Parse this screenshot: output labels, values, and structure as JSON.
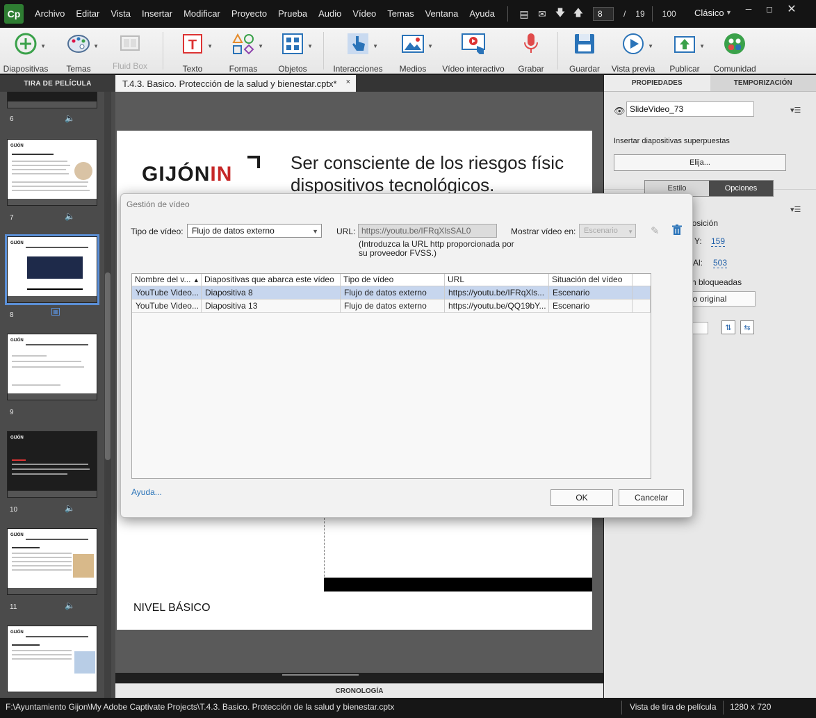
{
  "menubar": {
    "logo": "Cp",
    "items": [
      "Archivo",
      "Editar",
      "Vista",
      "Insertar",
      "Modificar",
      "Proyecto",
      "Prueba",
      "Audio",
      "Vídeo",
      "Temas",
      "Ventana",
      "Ayuda"
    ],
    "current_slide": "8",
    "slide_separator": "/",
    "total_slides": "19",
    "zoom": "100",
    "workspace": "Clásico"
  },
  "toolbar": {
    "diapositivas": "Diapositivas",
    "temas": "Temas",
    "fluid_box": "Fluid Box",
    "texto": "Texto",
    "formas": "Formas",
    "objetos": "Objetos",
    "interacciones": "Interacciones",
    "medios": "Medios",
    "video_interactivo": "Vídeo interactivo",
    "grabar": "Grabar",
    "guardar": "Guardar",
    "vista_previa": "Vista previa",
    "publicar": "Publicar",
    "comunidad": "Comunidad"
  },
  "filmstrip": {
    "header": "TIRA DE PELÍCULA",
    "slides": [
      {
        "num": "6"
      },
      {
        "num": "7"
      },
      {
        "num": "8"
      },
      {
        "num": "9"
      },
      {
        "num": "10"
      },
      {
        "num": "11"
      }
    ]
  },
  "document": {
    "tab_title": "T.4.3. Basico. Protección de la salud y bienestar.cptx*",
    "tab_close": "×"
  },
  "slide": {
    "logo_text": "GIJÓN",
    "logo_accent": "IN",
    "title_line1": "Ser consciente de los riesgos físic",
    "title_line2": "dispositivos tecnológicos.",
    "footer": "NIVEL BÁSICO"
  },
  "timeline": {
    "label": "CRONOLOGÍA"
  },
  "properties": {
    "tab_props": "PROPIEDADES",
    "tab_timing": "TEMPORIZACIÓN",
    "object_name": "SlideVideo_73",
    "overlay_label": "Insertar diapositivas superpuestas",
    "choose_button": "Elija...",
    "seg_style": "Estilo",
    "seg_options": "Opciones",
    "position_label": "posición",
    "y_label": "Y:",
    "y_value": "159",
    "h_label": "Al:",
    "h_value": "503",
    "locked_label": "n bloqueadas",
    "orig_size_button": "ño original"
  },
  "statusbar": {
    "path": "F:\\Ayuntamiento Gijon\\My Adobe Captivate Projects\\T.4.3. Basico. Protección de la salud y bienestar.cptx",
    "view": "Vista de tira de película",
    "resolution": "1280 x 720"
  },
  "dialog": {
    "title": "Gestión de vídeo",
    "video_type_label": "Tipo de vídeo:",
    "video_type_value": "Flujo de datos externo",
    "url_label": "URL:",
    "url_value": "https://youtu.be/IFRqXlsSAL0",
    "url_hint": "(Introduzca la URL http proporcionada por su proveedor FVSS.)",
    "show_label": "Mostrar vídeo en:",
    "show_value": "Escenario",
    "columns": [
      "Nombre del v...",
      "Diapositivas que abarca este vídeo",
      "Tipo de vídeo",
      "URL",
      "Situación del vídeo"
    ],
    "rows": [
      [
        "YouTube Video...",
        "Diapositiva 8",
        "Flujo de datos externo",
        "https://youtu.be/IFRqXls...",
        "Escenario"
      ],
      [
        "YouTube Video...",
        "Diapositiva 13",
        "Flujo de datos externo",
        "https://youtu.be/QQ19bY...",
        "Escenario"
      ]
    ],
    "help_link": "Ayuda...",
    "ok_button": "OK",
    "cancel_button": "Cancelar"
  }
}
